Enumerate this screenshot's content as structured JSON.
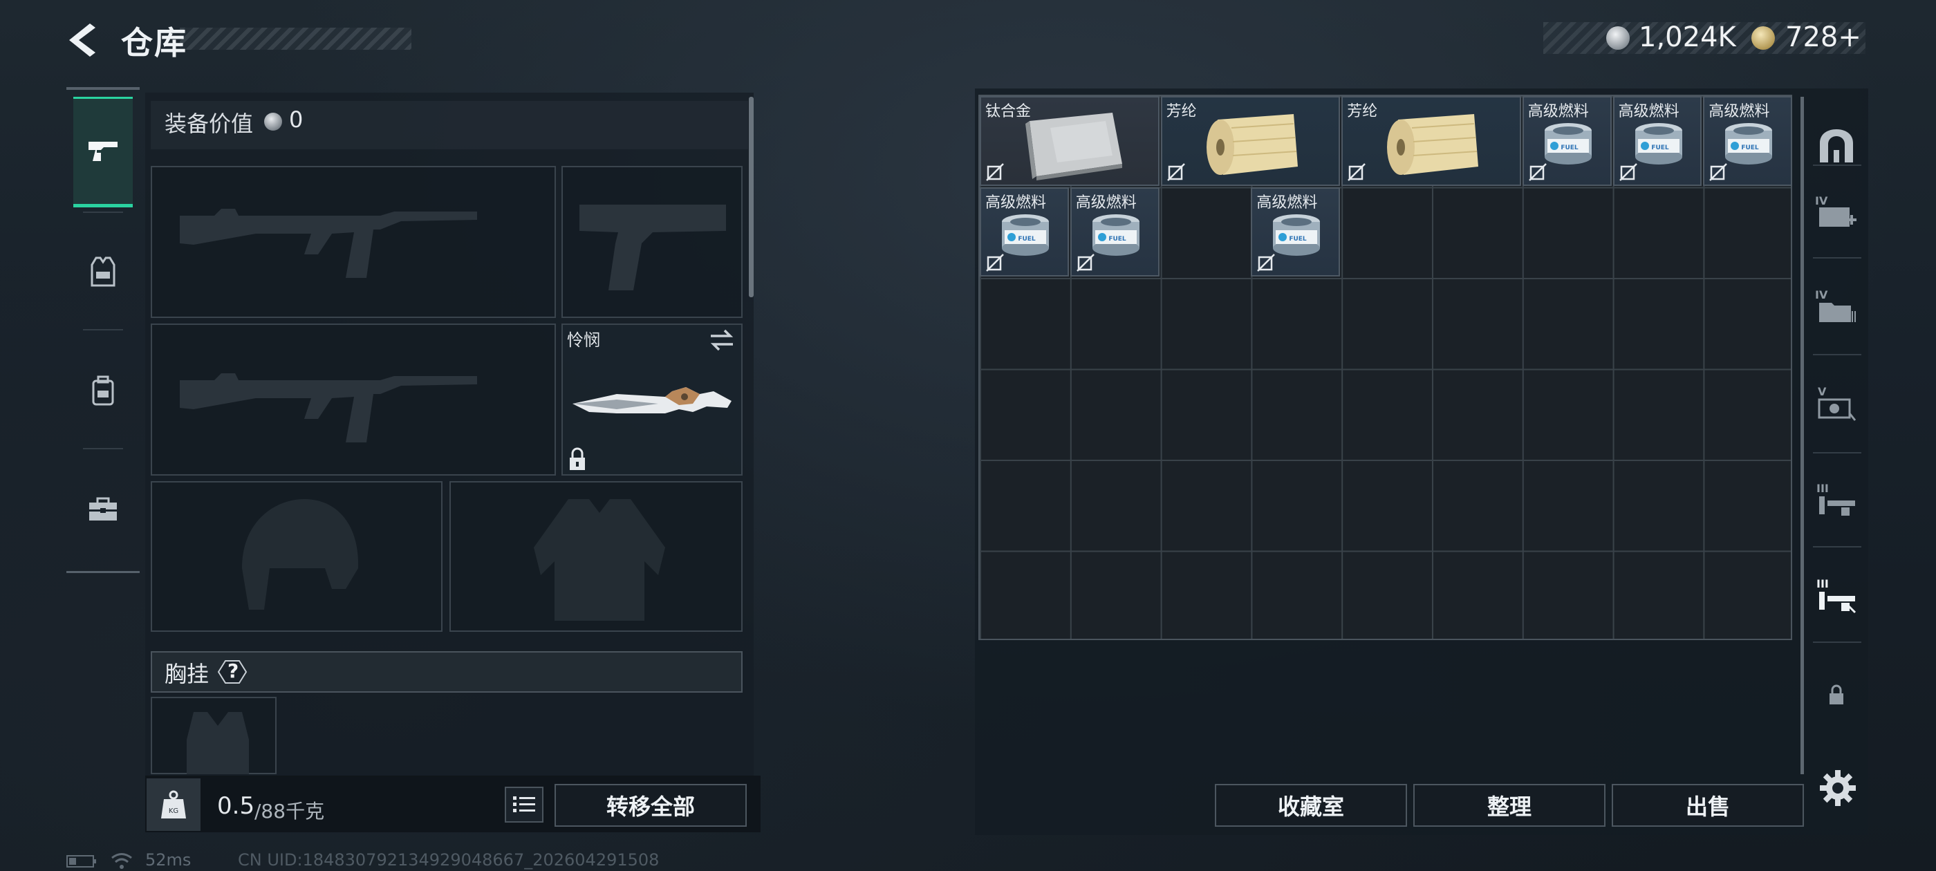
{
  "header": {
    "title": "仓库",
    "silver_currency": "1,024K",
    "gold_currency": "728",
    "gold_add": "+"
  },
  "left_rail": {
    "tabs": [
      {
        "name": "weapons",
        "icon": "pistol-icon",
        "active": true
      },
      {
        "name": "vest",
        "icon": "vest-icon"
      },
      {
        "name": "backpack",
        "icon": "backpack-icon"
      },
      {
        "name": "case",
        "icon": "toolbox-icon"
      }
    ]
  },
  "equipment": {
    "value_label": "装备价值",
    "value": "0",
    "melee_name": "怜悯",
    "chest_rig_label": "胸挂",
    "help": "?"
  },
  "bottom_left": {
    "weight_current": "0.5",
    "weight_max": "/88千克",
    "transfer_all": "转移全部"
  },
  "storage": {
    "items": [
      {
        "name": "钛合金",
        "kind": "titan",
        "col": 0,
        "row": 0,
        "w": 2,
        "h": 1
      },
      {
        "name": "芳纶",
        "kind": "aramid",
        "col": 2,
        "row": 0,
        "w": 2,
        "h": 1
      },
      {
        "name": "芳纶",
        "kind": "aramid",
        "col": 4,
        "row": 0,
        "w": 2,
        "h": 1
      },
      {
        "name": "高级燃料",
        "kind": "fuel",
        "col": 6,
        "row": 0,
        "w": 1,
        "h": 1
      },
      {
        "name": "高级燃料",
        "kind": "fuel",
        "col": 7,
        "row": 0,
        "w": 1,
        "h": 1
      },
      {
        "name": "高级燃料",
        "kind": "fuel",
        "col": 8,
        "row": 0,
        "w": 1,
        "h": 1
      },
      {
        "name": "高级燃料",
        "kind": "fuel",
        "col": 0,
        "row": 1,
        "w": 1,
        "h": 1
      },
      {
        "name": "高级燃料",
        "kind": "fuel",
        "col": 1,
        "row": 1,
        "w": 1,
        "h": 1
      },
      {
        "name": "高级燃料",
        "kind": "fuel",
        "col": 3,
        "row": 1,
        "w": 1,
        "h": 1
      }
    ],
    "collection_room": "收藏室",
    "organize": "整理",
    "sell": "出售"
  },
  "right_rail": {
    "tabs": [
      {
        "name": "storage-main",
        "icon": "arch-icon"
      },
      {
        "name": "storage-iv-1",
        "icon": "iv-case-icon",
        "label": "IV"
      },
      {
        "name": "storage-iv-2",
        "icon": "iv-folder-icon",
        "label": "IV"
      },
      {
        "name": "storage-v",
        "icon": "v-camera-icon",
        "label": "V"
      },
      {
        "name": "storage-iii-1",
        "icon": "iii-rack-icon",
        "label": "III"
      },
      {
        "name": "storage-iii-2",
        "icon": "iii-rack-active-icon",
        "label": "III"
      },
      {
        "name": "storage-locked",
        "icon": "lock-icon"
      }
    ]
  },
  "status": {
    "ping": "52ms",
    "uid": "CN UID:184830792134929048667_202604291508"
  },
  "colors": {
    "accent": "#2ad3a0",
    "panel": "#141c23",
    "border": "#4a545d"
  }
}
